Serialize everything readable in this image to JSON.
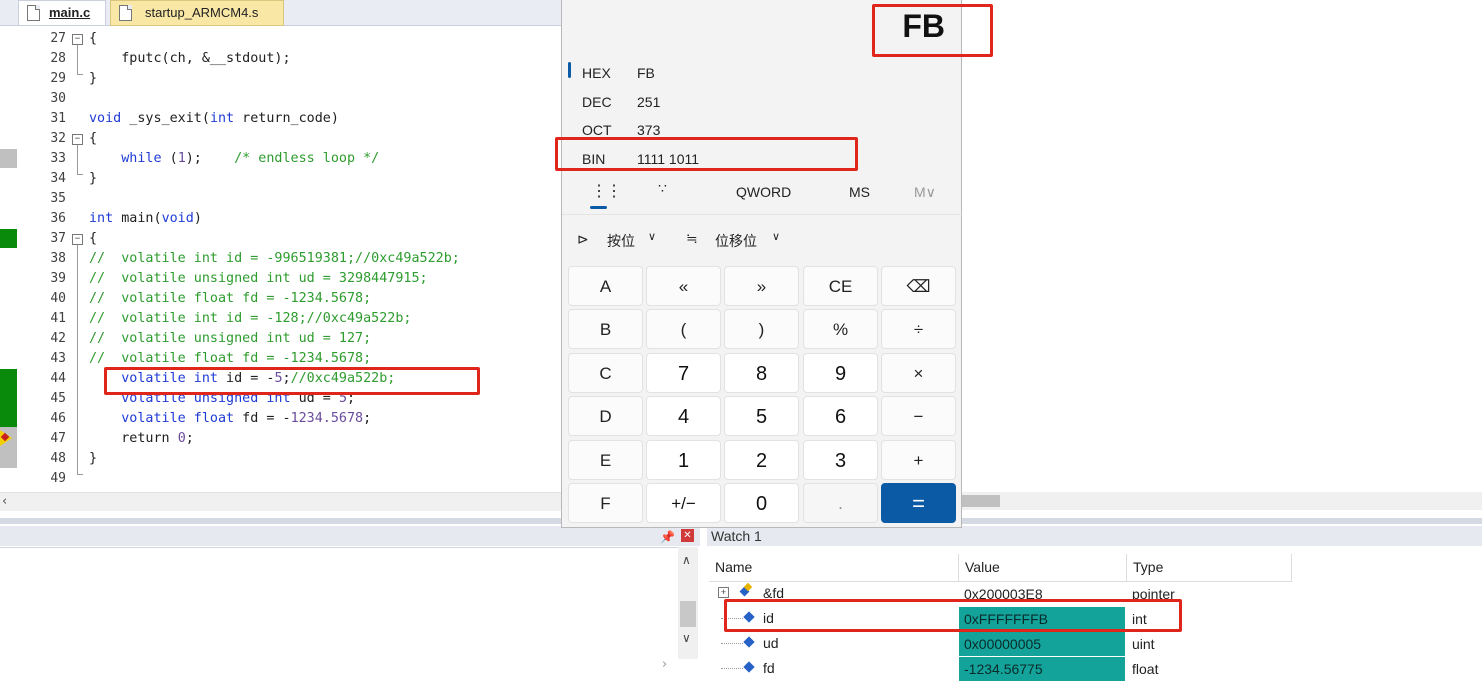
{
  "tabs": [
    {
      "label": "main.c"
    },
    {
      "label": "startup_ARMCM4.s"
    }
  ],
  "editor": {
    "lines": [
      {
        "num": "27"
      },
      {
        "num": "28"
      },
      {
        "num": "29"
      },
      {
        "num": "30"
      },
      {
        "num": "31"
      },
      {
        "num": "32"
      },
      {
        "num": "33"
      },
      {
        "num": "34"
      },
      {
        "num": "35"
      },
      {
        "num": "36"
      },
      {
        "num": "37"
      },
      {
        "num": "38"
      },
      {
        "num": "39"
      },
      {
        "num": "40"
      },
      {
        "num": "41"
      },
      {
        "num": "42"
      },
      {
        "num": "43"
      },
      {
        "num": "44"
      },
      {
        "num": "45"
      },
      {
        "num": "46"
      },
      {
        "num": "47"
      },
      {
        "num": "48"
      },
      {
        "num": "49"
      }
    ],
    "code": {
      "l27": "{",
      "l28": "    fputc(ch, &__stdout);",
      "l29": "}",
      "l31a": "void",
      "l31b": " _sys_exit(",
      "l31c": "int",
      "l31d": " return_code)",
      "l32": "{",
      "l33a": "    ",
      "l33b": "while",
      "l33c": " (",
      "l33d": "1",
      "l33e": ");    ",
      "l33f": "/* endless loop */",
      "l34": "}",
      "l36a": "int",
      "l36b": " main(",
      "l36c": "void",
      "l36d": ")",
      "l37": "{",
      "l38": "//  volatile int id = -996519381;//0xc49a522b;",
      "l39": "//  volatile unsigned int ud = 3298447915;",
      "l40": "//  volatile float fd = -1234.5678;",
      "l41": "//  volatile int id = -128;//0xc49a522b;",
      "l42": "//  volatile unsigned int ud = 127;",
      "l43": "//  volatile float fd = -1234.5678;",
      "l44a": "    ",
      "l44b": "volatile int",
      "l44c": " id = -",
      "l44d": "5",
      "l44e": ";",
      "l44f": "//0xc49a522b;",
      "l45a": "    ",
      "l45b": "volatile unsigned int",
      "l45c": " ud = ",
      "l45d": "5",
      "l45e": ";",
      "l46a": "    ",
      "l46b": "volatile float",
      "l46c": " fd = -",
      "l46d": "1234.5678",
      "l46e": ";",
      "l47a": "    return ",
      "l47b": "0",
      "l47c": ";",
      "l48": "}"
    }
  },
  "calculator": {
    "display": "FB",
    "bases": [
      {
        "name": "HEX",
        "value": "FB"
      },
      {
        "name": "DEC",
        "value": "251"
      },
      {
        "name": "OCT",
        "value": "373"
      },
      {
        "name": "BIN",
        "value": "1111 1011"
      }
    ],
    "modes": {
      "word_size": "QWORD",
      "ms": "MS",
      "m_dropdown": "M∨"
    },
    "ops": {
      "bitwise": "按位",
      "bitshift": "位移位"
    },
    "keys": [
      [
        "A",
        "«",
        "»",
        "CE",
        "⌫"
      ],
      [
        "B",
        "(",
        ")",
        "%",
        "÷"
      ],
      [
        "C",
        "7",
        "8",
        "9",
        "×"
      ],
      [
        "D",
        "4",
        "5",
        "6",
        "−"
      ],
      [
        "E",
        "1",
        "2",
        "3",
        "+"
      ],
      [
        "F",
        "+/−",
        "0",
        ".",
        "="
      ]
    ]
  },
  "watch": {
    "title": "Watch 1",
    "headers": {
      "name": "Name",
      "value": "Value",
      "type": "Type"
    },
    "rows": [
      {
        "name": "&fd",
        "value": "0x200003E8",
        "type": "pointer"
      },
      {
        "name": "id",
        "value": "0xFFFFFFFB",
        "type": "int"
      },
      {
        "name": "ud",
        "value": "0x00000005",
        "type": "uint"
      },
      {
        "name": "fd",
        "value": "-1234.56775",
        "type": "float"
      }
    ]
  },
  "colors": {
    "highlight_red": "#e0261b",
    "changed_value_teal": "#14a39a",
    "calc_accent": "#0b5aa5",
    "keyword_blue": "#1f3bd6",
    "comment_green": "#2e9c2e"
  }
}
